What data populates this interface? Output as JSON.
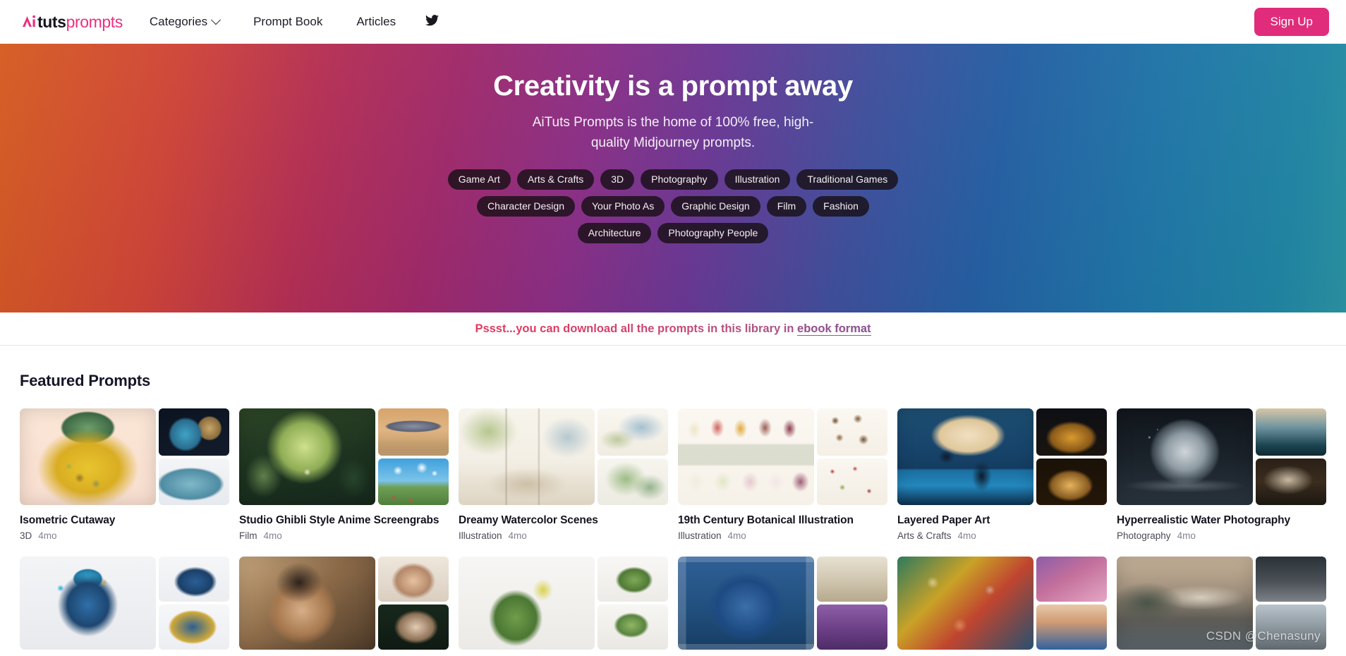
{
  "header": {
    "logo": {
      "mark": "ai-monogram-icon",
      "text_dark": "tuts",
      "text_accent": "prompts"
    },
    "nav": [
      {
        "label": "Categories",
        "has_dropdown": true,
        "icon": "chevron-down-icon"
      },
      {
        "label": "Prompt Book",
        "has_dropdown": false
      },
      {
        "label": "Articles",
        "has_dropdown": false
      }
    ],
    "social": {
      "icon": "twitter-icon",
      "label": "Twitter"
    },
    "signup_label": "Sign Up",
    "accent_color": "#e02c7b"
  },
  "hero": {
    "title": "Creativity is a prompt away",
    "subtitle": "AiTuts Prompts is the home of 100% free, high-quality Midjourney prompts.",
    "gradient_from": "#d4581c",
    "gradient_mid": "#8b2c86",
    "gradient_to": "#2c97a7",
    "tags": [
      "Game Art",
      "Arts & Crafts",
      "3D",
      "Photography",
      "Illustration",
      "Traditional Games",
      "Character Design",
      "Your Photo As",
      "Graphic Design",
      "Film",
      "Fashion",
      "Architecture",
      "Photography People"
    ]
  },
  "ebook_banner": {
    "text": "Pssst...you can download all the prompts in this library in ",
    "link_label": "ebook format"
  },
  "featured": {
    "heading": "Featured Prompts",
    "cards": [
      {
        "title": "Isometric Cutaway",
        "category": "3D",
        "age": "4mo"
      },
      {
        "title": "Studio Ghibli Style Anime Screengrabs",
        "category": "Film",
        "age": "4mo"
      },
      {
        "title": "Dreamy Watercolor Scenes",
        "category": "Illustration",
        "age": "4mo"
      },
      {
        "title": "19th Century Botanical Illustration",
        "category": "Illustration",
        "age": "4mo"
      },
      {
        "title": "Layered Paper Art",
        "category": "Arts & Crafts",
        "age": "4mo"
      },
      {
        "title": "Hyperrealistic Water Photography",
        "category": "Photography",
        "age": "4mo"
      }
    ],
    "row2_cards": [
      {
        "title": "",
        "category": "",
        "age": ""
      },
      {
        "title": "",
        "category": "",
        "age": ""
      },
      {
        "title": "",
        "category": "",
        "age": ""
      },
      {
        "title": "",
        "category": "",
        "age": ""
      },
      {
        "title": "",
        "category": "",
        "age": ""
      },
      {
        "title": "",
        "category": "",
        "age": ""
      }
    ]
  },
  "watermark": "CSDN @Chenasuny"
}
